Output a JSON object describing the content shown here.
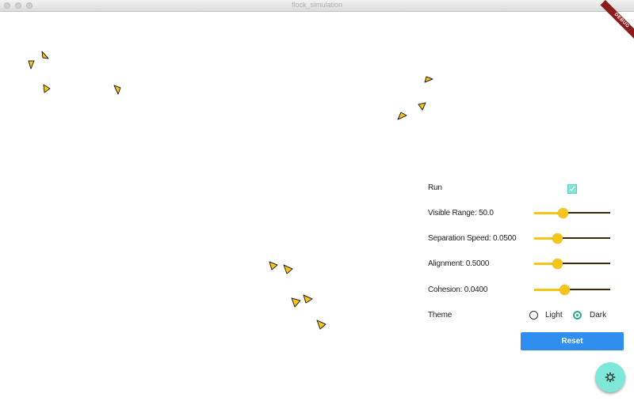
{
  "window": {
    "title": "flock_simulation"
  },
  "debug_banner": "DEBUG",
  "controls": {
    "run": {
      "label": "Run",
      "checked": true
    },
    "visible_range": {
      "label": "Visible Range: 50.0",
      "value": 0.38
    },
    "separation_speed": {
      "label": "Separation Speed: 0.0500",
      "value": 0.3
    },
    "alignment": {
      "label": "Alignment: 0.5000",
      "value": 0.3
    },
    "cohesion": {
      "label": "Cohesion: 0.0400",
      "value": 0.4
    },
    "theme": {
      "label": "Theme",
      "options": [
        "Light",
        "Dark"
      ],
      "selected": "Dark"
    },
    "reset_label": "Reset"
  },
  "fab": {
    "icon": "settings-icon"
  },
  "colors": {
    "boid": "#f5c518",
    "accent": "#7de8d8",
    "button": "#2f8eef"
  }
}
